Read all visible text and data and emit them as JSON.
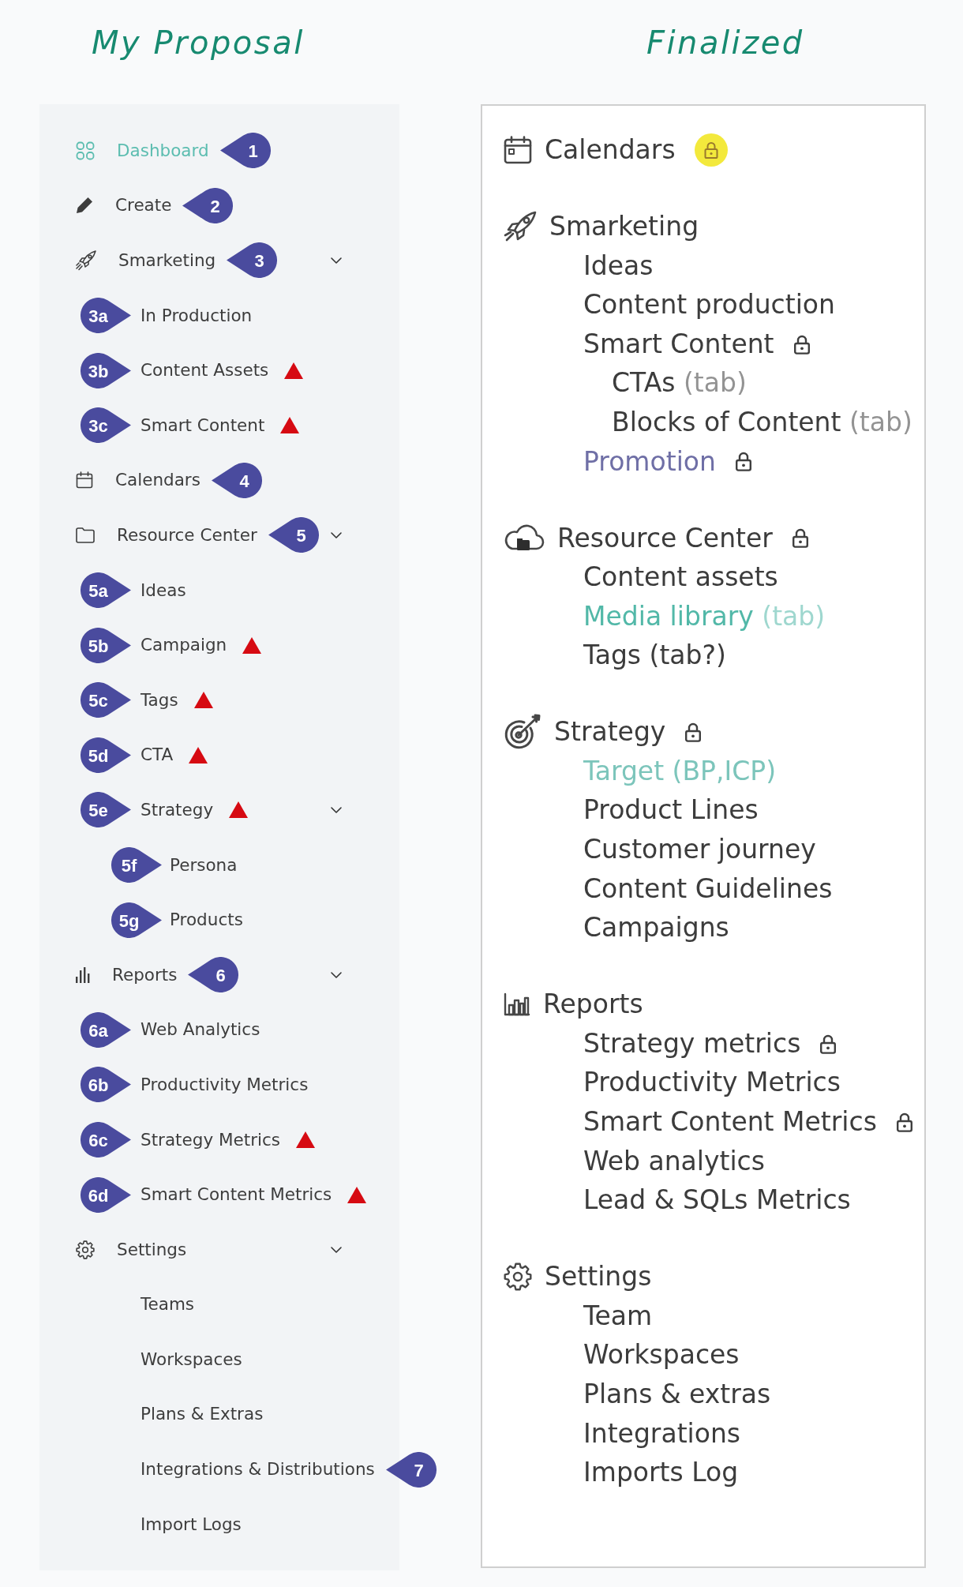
{
  "proposal": {
    "title": "My Proposal",
    "items": [
      {
        "label": "Dashboard",
        "selected": true,
        "flagged": false,
        "callout": {
          "text": "1",
          "kind": "trailing"
        }
      },
      {
        "label": "Create",
        "selected": false,
        "flagged": false,
        "callout": {
          "text": "2",
          "kind": "trailing"
        }
      },
      {
        "label": "Smarketing",
        "selected": false,
        "flagged": false,
        "expanded": true,
        "callout": {
          "text": "3",
          "kind": "trailing"
        },
        "children": [
          {
            "label": "In Production",
            "selected": false,
            "flagged": false,
            "callout": {
              "text": "3a",
              "kind": "leading"
            }
          },
          {
            "label": "Content Assets",
            "selected": false,
            "flagged": true,
            "callout": {
              "text": "3b",
              "kind": "leading"
            }
          },
          {
            "label": "Smart Content",
            "selected": false,
            "flagged": true,
            "callout": {
              "text": "3c",
              "kind": "leading"
            }
          }
        ]
      },
      {
        "label": "Calendars",
        "selected": false,
        "flagged": false,
        "callout": {
          "text": "4",
          "kind": "trailing"
        }
      },
      {
        "label": "Resource Center",
        "selected": false,
        "flagged": false,
        "expanded": true,
        "callout": {
          "text": "5",
          "kind": "trailing"
        },
        "children": [
          {
            "label": "Ideas",
            "selected": false,
            "flagged": false,
            "callout": {
              "text": "5a",
              "kind": "leading"
            }
          },
          {
            "label": "Campaign",
            "selected": false,
            "flagged": true,
            "callout": {
              "text": "5b",
              "kind": "leading"
            }
          },
          {
            "label": "Tags",
            "selected": false,
            "flagged": true,
            "callout": {
              "text": "5c",
              "kind": "leading"
            }
          },
          {
            "label": "CTA",
            "selected": false,
            "flagged": true,
            "callout": {
              "text": "5d",
              "kind": "leading"
            }
          },
          {
            "label": "Strategy",
            "selected": false,
            "flagged": true,
            "expanded": true,
            "callout": {
              "text": "5e",
              "kind": "leading"
            },
            "children": [
              {
                "label": "Persona",
                "selected": false,
                "flagged": false,
                "callout": {
                  "text": "5f",
                  "kind": "leading"
                }
              },
              {
                "label": "Products",
                "selected": false,
                "flagged": false,
                "callout": {
                  "text": "5g",
                  "kind": "leading"
                }
              }
            ]
          }
        ]
      },
      {
        "label": "Reports",
        "selected": false,
        "flagged": false,
        "expanded": true,
        "callout": {
          "text": "6",
          "kind": "trailing"
        },
        "children": [
          {
            "label": "Web Analytics",
            "selected": false,
            "flagged": false,
            "callout": {
              "text": "6a",
              "kind": "leading"
            }
          },
          {
            "label": "Productivity Metrics",
            "selected": false,
            "flagged": false,
            "callout": {
              "text": "6b",
              "kind": "leading"
            }
          },
          {
            "label": "Strategy Metrics",
            "selected": false,
            "flagged": true,
            "callout": {
              "text": "6c",
              "kind": "leading"
            }
          },
          {
            "label": "Smart Content Metrics",
            "selected": false,
            "flagged": true,
            "callout": {
              "text": "6d",
              "kind": "leading"
            }
          }
        ]
      },
      {
        "label": "Settings",
        "selected": false,
        "flagged": false,
        "expanded": true,
        "children": [
          {
            "label": "Teams",
            "selected": false,
            "flagged": false
          },
          {
            "label": "Workspaces",
            "selected": false,
            "flagged": false
          },
          {
            "label": "Plans & Extras",
            "selected": false,
            "flagged": false
          },
          {
            "label": "Integrations & Distributions",
            "selected": false,
            "flagged": false,
            "callout": {
              "text": "7",
              "kind": "trailing"
            }
          },
          {
            "label": "Import Logs",
            "selected": false,
            "flagged": false
          }
        ]
      }
    ]
  },
  "finalized": {
    "title": "Finalized",
    "sections": [
      {
        "label": "Calendars",
        "locked": true,
        "lock_highlighted": true
      },
      {
        "label": "Smarketing",
        "locked": false,
        "items": [
          {
            "label": "Ideas",
            "locked": false
          },
          {
            "label": "Content production",
            "locked": false
          },
          {
            "label": "Smart Content",
            "locked": true,
            "children": [
              {
                "label": "CTAs",
                "note": "(tab)",
                "locked": false
              },
              {
                "label": "Blocks of Content",
                "note": "(tab)",
                "locked": false
              }
            ]
          },
          {
            "label": "Promotion",
            "color": "#6f6fa6",
            "locked": true
          }
        ]
      },
      {
        "label": "Resource Center",
        "locked": true,
        "lock_highlighted": false,
        "items": [
          {
            "label": "Content assets",
            "locked": false
          },
          {
            "label": "Media library",
            "note": "(tab)",
            "color": "#52b8a8",
            "locked": false
          },
          {
            "label": "Tags (tab?)",
            "locked": false
          }
        ]
      },
      {
        "label": "Strategy",
        "locked": true,
        "lock_highlighted": false,
        "items": [
          {
            "label": "Target (BP,ICP)",
            "color": "#7cc5bb",
            "locked": false
          },
          {
            "label": "Product Lines",
            "locked": false
          },
          {
            "label": "Customer journey",
            "locked": false
          },
          {
            "label": "Content Guidelines",
            "locked": false
          },
          {
            "label": "Campaigns",
            "locked": false
          }
        ]
      },
      {
        "label": "Reports",
        "locked": false,
        "items": [
          {
            "label": "Strategy metrics",
            "locked": true
          },
          {
            "label": "Productivity Metrics",
            "locked": false
          },
          {
            "label": "Smart Content Metrics",
            "locked": true
          },
          {
            "label": "Web analytics",
            "locked": false
          },
          {
            "label": "Lead & SQLs Metrics",
            "locked": false
          }
        ]
      },
      {
        "label": "Settings",
        "locked": false,
        "items": [
          {
            "label": "Team",
            "locked": false
          },
          {
            "label": "Workspaces",
            "locked": false
          },
          {
            "label": "Plans & extras",
            "locked": false
          },
          {
            "label": "Integrations",
            "locked": false
          },
          {
            "label": "Imports Log",
            "locked": false
          }
        ]
      }
    ]
  }
}
